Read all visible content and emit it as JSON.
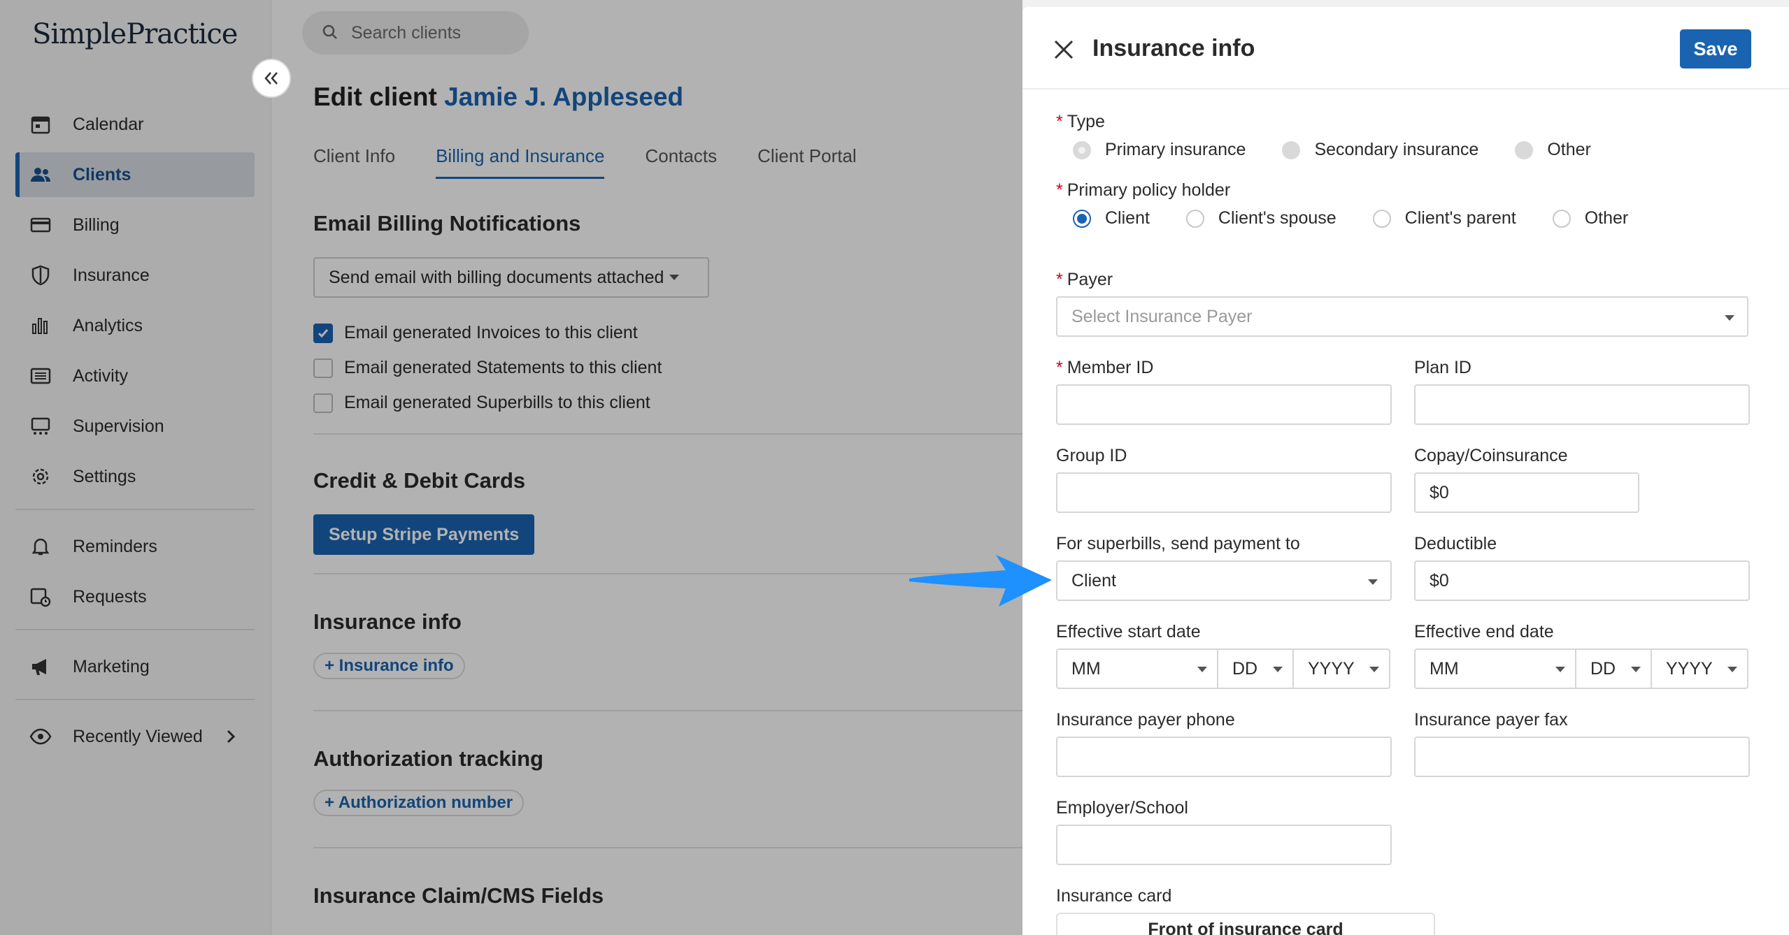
{
  "sidebar": {
    "logo": "SimplePractice",
    "items": [
      {
        "label": "Calendar",
        "icon": "calendar-icon"
      },
      {
        "label": "Clients",
        "icon": "users-icon"
      },
      {
        "label": "Billing",
        "icon": "credit-card-icon"
      },
      {
        "label": "Insurance",
        "icon": "shield-icon"
      },
      {
        "label": "Analytics",
        "icon": "bar-chart-icon"
      },
      {
        "label": "Activity",
        "icon": "list-icon"
      },
      {
        "label": "Supervision",
        "icon": "supervision-icon"
      },
      {
        "label": "Settings",
        "icon": "gear-icon"
      },
      {
        "label": "Reminders",
        "icon": "bell-icon"
      },
      {
        "label": "Requests",
        "icon": "calendar-clock-icon"
      },
      {
        "label": "Marketing",
        "icon": "megaphone-icon"
      },
      {
        "label": "Recently Viewed",
        "icon": "eye-icon"
      }
    ],
    "active": "Clients"
  },
  "main": {
    "search_placeholder": "Search clients",
    "title_prefix": "Edit client",
    "client_name": "Jamie J. Appleseed",
    "tabs": [
      "Client Info",
      "Billing and Insurance",
      "Contacts",
      "Client Portal"
    ],
    "active_tab": "Billing and Insurance",
    "email_section": {
      "title": "Email Billing Notifications",
      "select_value": "Send email with billing documents attached",
      "checkboxes": [
        {
          "label": "Email generated Invoices to this client",
          "checked": true
        },
        {
          "label": "Email generated Statements to this client",
          "checked": false
        },
        {
          "label": "Email generated Superbills to this client",
          "checked": false
        }
      ]
    },
    "cards_section": {
      "title": "Credit & Debit Cards",
      "button": "Setup Stripe Payments"
    },
    "insurance_section": {
      "title": "Insurance info",
      "link": "+ Insurance info"
    },
    "auth_section": {
      "title": "Authorization tracking",
      "link": "+ Authorization number"
    },
    "claim_section": {
      "title": "Insurance Claim/CMS Fields"
    }
  },
  "drawer": {
    "title": "Insurance info",
    "save_label": "Save",
    "type_label": "Type",
    "type_options": [
      "Primary insurance",
      "Secondary insurance",
      "Other"
    ],
    "holder_label": "Primary policy holder",
    "holder_options": [
      "Client",
      "Client's spouse",
      "Client's parent",
      "Other"
    ],
    "holder_selected": "Client",
    "payer_label": "Payer",
    "payer_placeholder": "Select Insurance Payer",
    "member_id_label": "Member ID",
    "member_id_value": "",
    "plan_id_label": "Plan ID",
    "plan_id_value": "",
    "group_id_label": "Group ID",
    "group_id_value": "",
    "copay_label": "Copay/Coinsurance",
    "copay_value": "$0",
    "superbill_label": "For superbills, send payment to",
    "superbill_value": "Client",
    "deductible_label": "Deductible",
    "deductible_value": "$0",
    "start_date_label": "Effective start date",
    "end_date_label": "Effective end date",
    "date_month": "MM",
    "date_day": "DD",
    "date_year": "YYYY",
    "phone_label": "Insurance payer phone",
    "phone_value": "",
    "fax_label": "Insurance payer fax",
    "fax_value": "",
    "employer_label": "Employer/School",
    "employer_value": "",
    "card_label": "Insurance card",
    "card_front": "Front of insurance card"
  },
  "colors": {
    "accent": "#1a63b0",
    "arrow": "#1e90ff",
    "required": "#d0021b"
  }
}
